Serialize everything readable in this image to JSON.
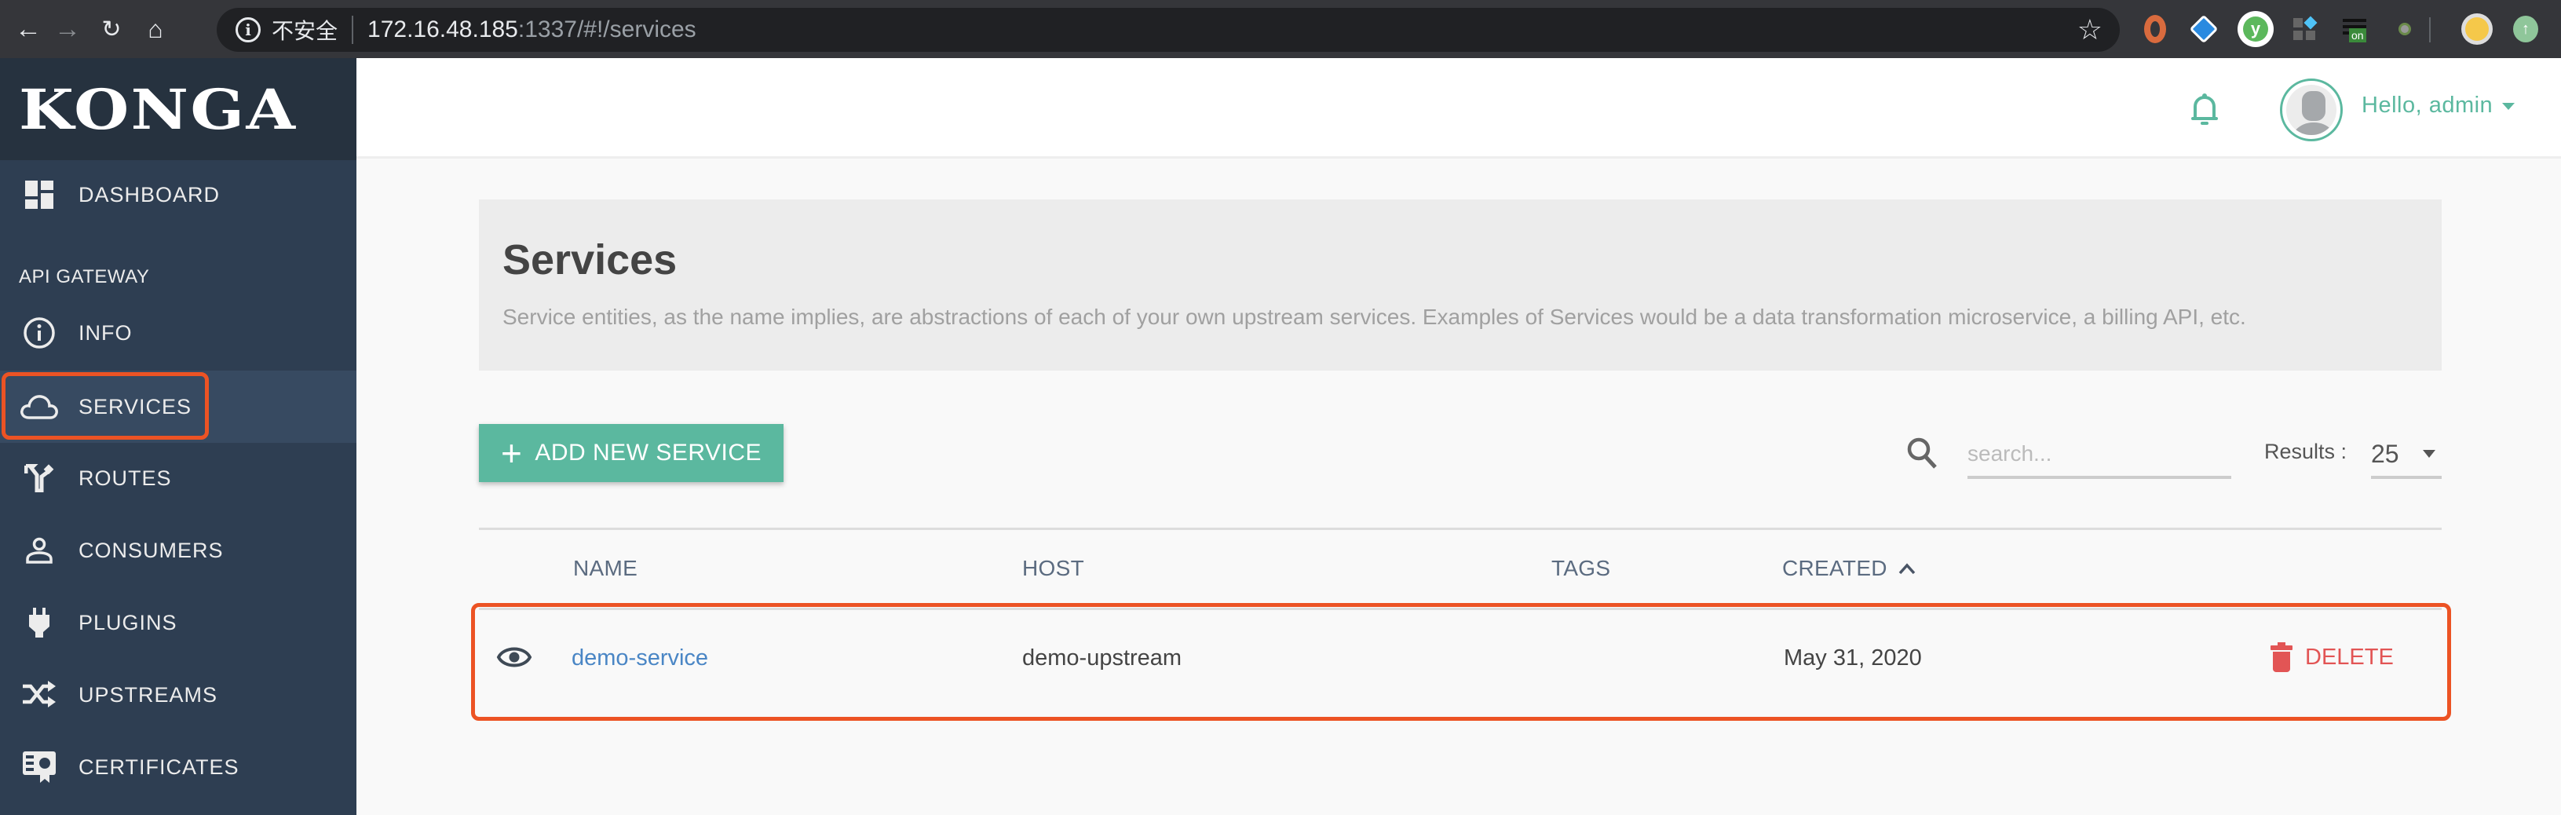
{
  "browser": {
    "insecure_label": "不安全",
    "url_host": "172.16.48.185",
    "url_path": ":1337/#!/services",
    "extension_badge": "on"
  },
  "sidebar": {
    "logo": "KONGA",
    "dashboard_label": "DASHBOARD",
    "section_label": "API GATEWAY",
    "items": [
      {
        "label": "INFO",
        "icon": "info-icon"
      },
      {
        "label": "SERVICES",
        "icon": "cloud-icon",
        "active": true
      },
      {
        "label": "ROUTES",
        "icon": "fork-icon"
      },
      {
        "label": "CONSUMERS",
        "icon": "person-icon"
      },
      {
        "label": "PLUGINS",
        "icon": "plug-icon"
      },
      {
        "label": "UPSTREAMS",
        "icon": "shuffle-icon"
      },
      {
        "label": "CERTIFICATES",
        "icon": "certificate-icon"
      }
    ]
  },
  "header": {
    "greeting": "Hello, admin"
  },
  "page": {
    "title": "Services",
    "description": "Service entities, as the name implies, are abstractions of each of your own upstream services. Examples of Services would be a data transformation microservice, a billing API, etc.",
    "add_button": "ADD NEW SERVICE",
    "search_placeholder": "search...",
    "results_label": "Results :",
    "results_value": "25"
  },
  "table": {
    "columns": [
      "NAME",
      "HOST",
      "TAGS",
      "CREATED"
    ],
    "sort_column": "CREATED",
    "sort_direction": "asc",
    "rows": [
      {
        "name": "demo-service",
        "host": "demo-upstream",
        "tags": "",
        "created": "May 31, 2020",
        "action": "DELETE"
      }
    ]
  },
  "colors": {
    "accent": "#5bb89f",
    "sidebar_bg": "#2e3e52",
    "highlight": "#ec5324",
    "danger": "#e25555",
    "link": "#4a86c5"
  }
}
